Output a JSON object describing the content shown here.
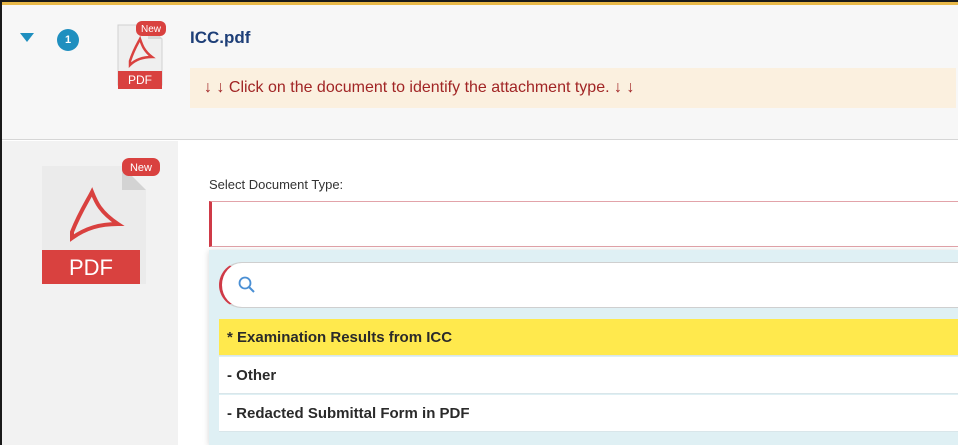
{
  "header": {
    "count": "1",
    "file_name": "ICC.pdf",
    "notice": "↓ ↓ Click on the document to identify the attachment type. ↓ ↓",
    "new_badge": "New",
    "pdf_label": "PDF"
  },
  "preview": {
    "new_badge": "New",
    "pdf_label": "PDF"
  },
  "form": {
    "select_label": "Select Document Type:",
    "search_placeholder": ""
  },
  "options": [
    "* Examination Results from ICC",
    "- Other",
    "- Redacted Submittal Form in PDF"
  ],
  "colors": {
    "accent_blue": "#1f8fbf",
    "title_blue": "#1e3f78",
    "notice_red": "#a12525",
    "pdf_red": "#d9413f",
    "highlight_yellow": "#ffe94d"
  }
}
